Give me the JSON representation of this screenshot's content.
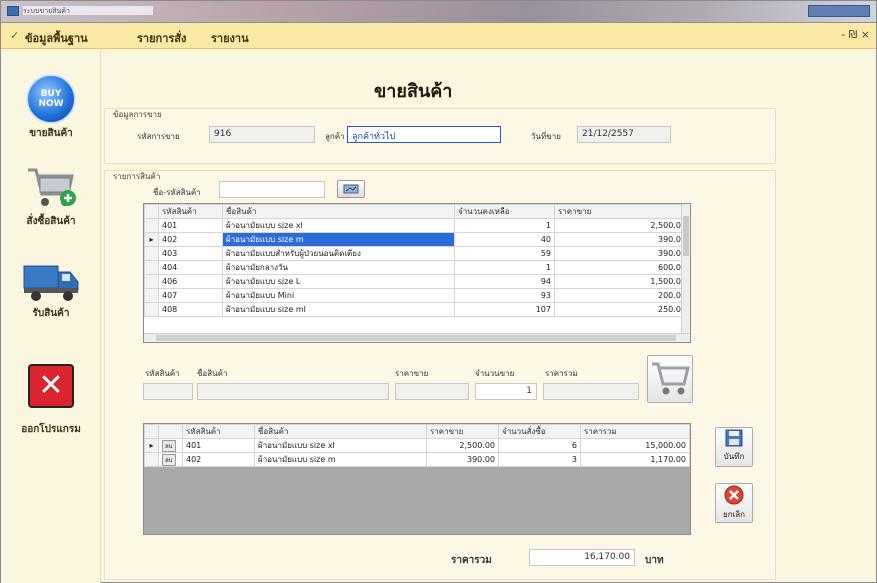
{
  "window": {
    "title": "ระบบขายสินค้า"
  },
  "menu": {
    "items": [
      "ข้อมูลพื้นฐาน",
      "รายการสั่ง",
      "รายงาน"
    ],
    "controls": "- ₪ ×"
  },
  "sidebar": {
    "buy_icon_text": [
      "BUY",
      "NOW"
    ],
    "items": [
      {
        "label": "ขายสินค้า",
        "icon": "buy-now-icon"
      },
      {
        "label": "สั่งซื้อสินค้า",
        "icon": "shopping-cart-icon"
      },
      {
        "label": "รับสินค้า",
        "icon": "truck-icon"
      },
      {
        "label": "ออกโปรแกรม",
        "icon": "exit-icon"
      }
    ]
  },
  "page_title": "ขายสินค้า",
  "sale_info": {
    "caption": "ข้อมูลการขาย",
    "sale_id_label": "รหัสการขาย",
    "sale_id": "916",
    "customer_label": "ลูกค้า",
    "customer": "ลูกค้าทั่วไป",
    "date_label": "วันที่ขาย",
    "date": "21/12/2557"
  },
  "product_section": {
    "caption": "รายการสินค้า",
    "search_label": "ชื่อ-รหัสสินค้า",
    "search_value": "",
    "columns": [
      "รหัสสินค้า",
      "ชื่อสินค้า",
      "จำนวนคงเหลือ",
      "ราคาขาย"
    ],
    "rows": [
      [
        "401",
        "ผ้าอนามัยแบบ size xl",
        "1",
        "2,500.00"
      ],
      [
        "402",
        "ผ้าอนามัยแบบ size m",
        "40",
        "390.00"
      ],
      [
        "403",
        "ผ้าอนามัยแบบสำหรับผู้ป่วยนอนติดเตียง",
        "59",
        "390.00"
      ],
      [
        "404",
        "ผ้าอนามัยกลางวัน",
        "1",
        "600.00"
      ],
      [
        "406",
        "ผ้าอนามัยแบบ size L",
        "94",
        "1,500.00"
      ],
      [
        "407",
        "ผ้าอนามัยแบบ Mini",
        "93",
        "200.00"
      ],
      [
        "408",
        "ผ้าอนามัยแบบ size ml",
        "107",
        "250.00"
      ]
    ],
    "selected_index": 1
  },
  "item_entry": {
    "code_label": "รหัสสินค้า",
    "name_label": "ชื่อสินค้า",
    "price_label": "ราคาขาย",
    "qty_label": "จำนวนขาย",
    "total_label": "ราคารวม",
    "code": "",
    "name": "",
    "price": "",
    "qty": "1",
    "total": ""
  },
  "cart": {
    "columns": [
      "รหัสสินค้า",
      "ชื่อสินค้า",
      "ราคาขาย",
      "จำนวนสั่งซื้อ",
      "ราคารวม"
    ],
    "row_button": "ลบ",
    "rows": [
      [
        "401",
        "ผ้าอนามัยแบบ size xl",
        "2,500.00",
        "6",
        "15,000.00"
      ],
      [
        "402",
        "ผ้าอนามัยแบบ size m",
        "390.00",
        "3",
        "1,170.00"
      ]
    ]
  },
  "buttons": {
    "save": "บันทึก",
    "cancel": "ยกเลิก"
  },
  "grand_total": {
    "label": "ราคารวม",
    "value": "16,170.00",
    "unit": "บาท"
  }
}
